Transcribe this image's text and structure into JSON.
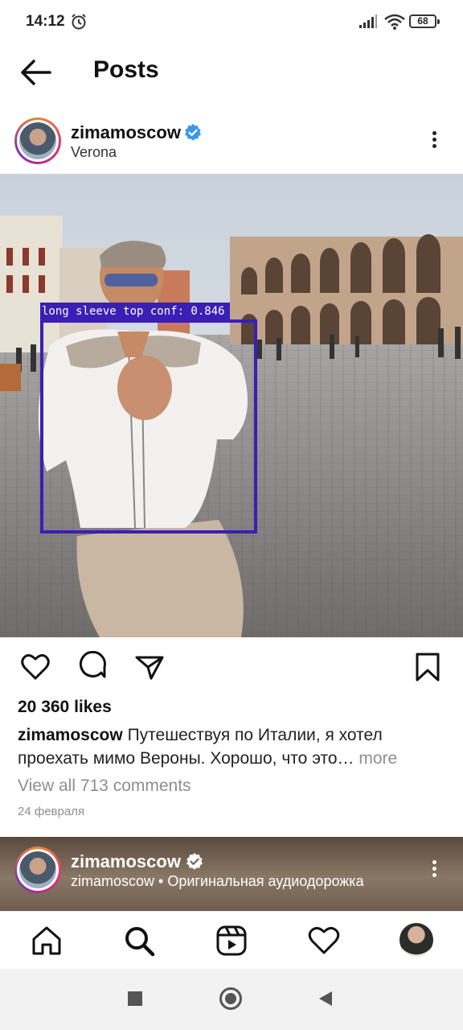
{
  "status_bar": {
    "time": "14:12",
    "battery": "68"
  },
  "header": {
    "title": "Posts"
  },
  "post": {
    "username": "zimamoscow",
    "location": "Verona",
    "detection_label": "long sleeve top conf: 0.846",
    "likes": "20 360 likes",
    "caption_user": "zimamoscow",
    "caption_text": "Путешествуя по Италии, я хотел проехать мимо Вероны. Хорошо, что это…",
    "caption_more": "more",
    "comments_link": "View all 713 comments",
    "date": "24 февраля"
  },
  "next_post": {
    "username": "zimamoscow",
    "subtitle": "zimamoscow • Оригинальная аудиодорожка"
  },
  "icons": {
    "verified": "verified-badge-icon",
    "actions": [
      "heart-icon",
      "comment-icon",
      "share-icon",
      "bookmark-icon"
    ],
    "nav": [
      "home-icon",
      "search-icon",
      "reels-icon",
      "heart-icon",
      "profile-avatar"
    ],
    "system": [
      "recents-square-icon",
      "home-circle-icon",
      "back-triangle-icon"
    ]
  },
  "colors": {
    "accent": "#3a1fb5",
    "verified": "#3897f0",
    "muted": "#8e8e8e"
  }
}
